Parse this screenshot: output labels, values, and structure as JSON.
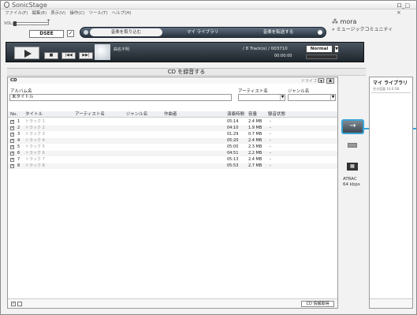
{
  "app": {
    "name": "SonicStage",
    "win_controls": "ロ_□ ×"
  },
  "menu": [
    "ファイル(F)",
    "編集(E)",
    "表示(V)",
    "操作(C)",
    "ツール(T)",
    "ヘルプ(H)"
  ],
  "control": {
    "vol_label": "VOL",
    "dsee_label": "DSEE",
    "dsee_checked": "✓",
    "mora": "⁂ mora",
    "community": "» ミュージックコミュニティ"
  },
  "mode_tabs": [
    "音楽を取り込む",
    "マイ ライブラリ",
    "音楽を転送する"
  ],
  "player": {
    "track_info": "曲名不明",
    "counter": "/ 8 Track(s) / 003710",
    "time": "00:00:00",
    "mode": "Normal",
    "prev": "|◀◀",
    "next": "▶▶|",
    "stop": "■"
  },
  "record": {
    "title": "CD を録音する"
  },
  "cd": {
    "label": "CD",
    "drive_label": "ドライブ選択",
    "eject": "▲",
    "album_label": "アルバム名",
    "album_value": "未タイトル",
    "artist_label": "アーティスト名",
    "genre_label": "ジャンル名",
    "headers": [
      "No.",
      "タイトル",
      "アーティスト名",
      "ジャンル名",
      "作曲者",
      "演奏時間",
      "容量",
      "録音状態"
    ],
    "tracks": [
      {
        "no": "1",
        "title": "トラック 1",
        "time": "05:14",
        "size": "2.4 MB",
        "status": "-"
      },
      {
        "no": "2",
        "title": "トラック 2",
        "time": "04:10",
        "size": "1.9 MB",
        "status": "-"
      },
      {
        "no": "3",
        "title": "トラック 3",
        "time": "01:29",
        "size": "0.7 MB",
        "status": "-"
      },
      {
        "no": "4",
        "title": "トラック 4",
        "time": "05:20",
        "size": "2.4 MB",
        "status": "-"
      },
      {
        "no": "5",
        "title": "トラック 5",
        "time": "05:00",
        "size": "2.3 MB",
        "status": "-"
      },
      {
        "no": "6",
        "title": "トラック 6",
        "time": "04:51",
        "size": "2.2 MB",
        "status": "-"
      },
      {
        "no": "7",
        "title": "トラック 7",
        "time": "05:13",
        "size": "2.4 MB",
        "status": "-"
      },
      {
        "no": "8",
        "title": "トラック 8",
        "time": "05:53",
        "size": "2.7 MB",
        "status": "-"
      }
    ],
    "cd_info_button": "CD 情報取得"
  },
  "transfer": {
    "arrow": "→",
    "device_label": "ATRAC\n64 kbps"
  },
  "library": {
    "title": "マイ ライブラリ",
    "sub": "空き容量 10.0 GB"
  },
  "colors": {
    "accent": "#3aa3d6",
    "dark": "#27323d"
  }
}
